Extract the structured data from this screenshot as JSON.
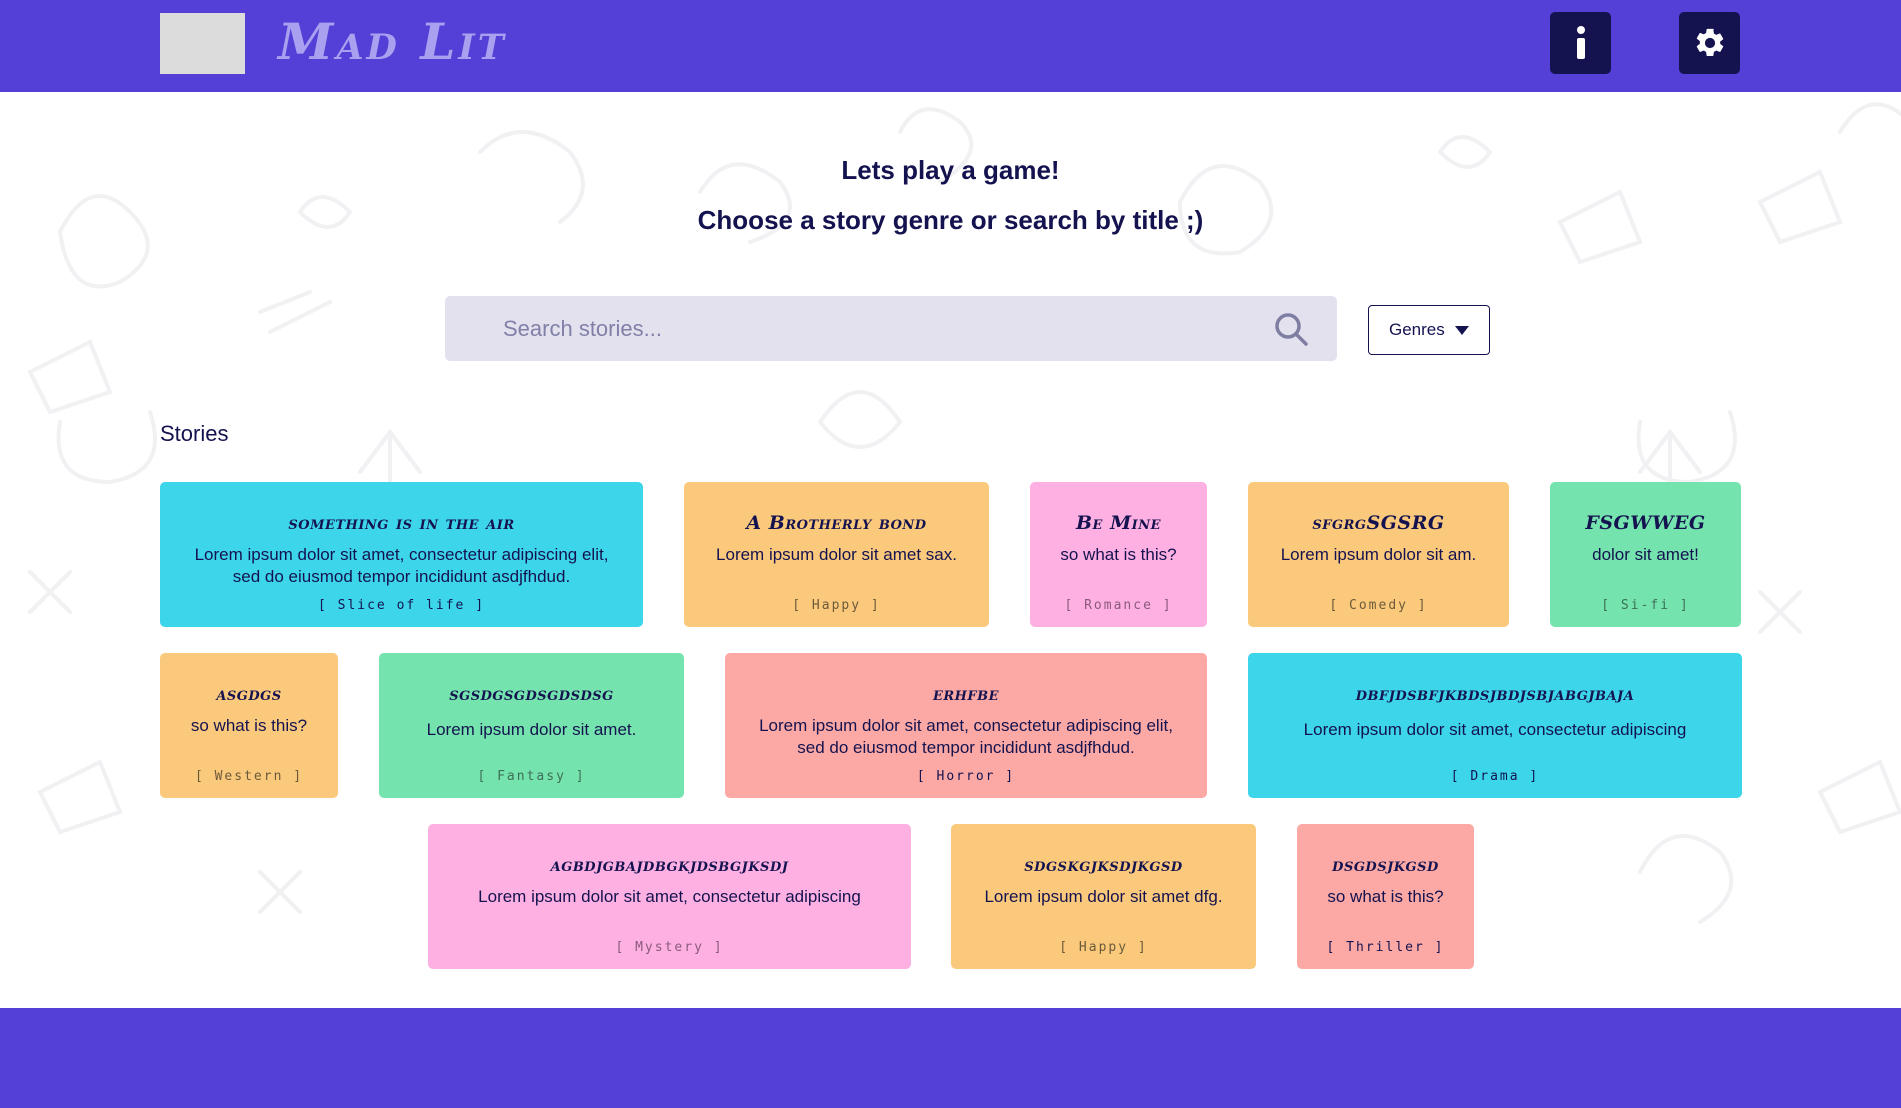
{
  "app": {
    "brand": "Mad Lit"
  },
  "header": {
    "info_icon": "info-icon",
    "settings_icon": "gear-icon"
  },
  "intro": {
    "line1": "Lets play a game!",
    "line2": "Choose a story genre or search by title ;)"
  },
  "search": {
    "placeholder": "Search stories...",
    "value": "",
    "icon": "search-icon"
  },
  "genres_dropdown": {
    "label": "Genres",
    "icon": "caret-down-icon"
  },
  "stories_heading": "Stories",
  "colors": {
    "brand": "#5440d6",
    "navy": "#14134f",
    "cyan": "#3dd5ea",
    "orange": "#fbc97c",
    "pink": "#feb0e3",
    "green": "#74e3ae",
    "salmon": "#fca9a5"
  },
  "stories": [
    {
      "title": "something is in the air",
      "description": "Lorem ipsum dolor sit amet, consectetur adipiscing elit, sed do eiusmod tempor incididunt asdjfhdud.",
      "genre": "[ Slice of life ]",
      "color": "#3dd5ea",
      "genre_color": "#14134f"
    },
    {
      "title": "A Brotherly bond",
      "description": "Lorem ipsum dolor sit amet sax.",
      "genre": "[ Happy ]",
      "color": "#fbc97c",
      "genre_color": "#6b5a3a"
    },
    {
      "title": "Be Mine",
      "description": "so what is this?",
      "genre": "[ Romance ]",
      "color": "#feb0e3",
      "genre_color": "#8a5a7e"
    },
    {
      "title": "sfgrgSGSRG",
      "description": "Lorem ipsum dolor sit am.",
      "genre": "[ Comedy ]",
      "color": "#fbc97c",
      "genre_color": "#6b5a3a"
    },
    {
      "title": "FSGWWEG",
      "description": "dolor sit amet!",
      "genre": "[ Si-fi ]",
      "color": "#74e3ae",
      "genre_color": "#3e6f57"
    },
    {
      "title": "asgdgs",
      "description": "so what is this?",
      "genre": "[ Western ]",
      "color": "#fbc97c",
      "genre_color": "#6b5a3a"
    },
    {
      "title": "sgsdgsgdsgdsdsg",
      "description": "Lorem ipsum dolor sit amet.",
      "genre": "[ Fantasy ]",
      "color": "#74e3ae",
      "genre_color": "#3e6f57"
    },
    {
      "title": "erhfbe",
      "description": "Lorem ipsum dolor sit amet, consectetur adipiscing elit, sed do eiusmod tempor incididunt asdjfhdud.",
      "genre": "[ Horror ]",
      "color": "#fca9a5",
      "genre_color": "#14134f"
    },
    {
      "title": "dbfjdsbfjkbdsjbdjsbjabgjbaja",
      "description": "Lorem ipsum dolor sit amet, consectetur adipiscing",
      "genre": "[ Drama ]",
      "color": "#3dd5ea",
      "genre_color": "#14134f"
    },
    {
      "title": "agbdjgbajdbgkjdsbgjksdj",
      "description": "Lorem ipsum dolor sit amet, consectetur adipiscing",
      "genre": "[ Mystery ]",
      "color": "#feb0e3",
      "genre_color": "#8a5a7e"
    },
    {
      "title": "sdgskgjksdjkgsd",
      "description": "Lorem ipsum dolor sit amet dfg.",
      "genre": "[ Happy ]",
      "color": "#fbc97c",
      "genre_color": "#6b5a3a"
    },
    {
      "title": "dsgdsjkgsd",
      "description": "so what is this?",
      "genre": "[ Thriller ]",
      "color": "#fca9a5",
      "genre_color": "#14134f"
    }
  ]
}
